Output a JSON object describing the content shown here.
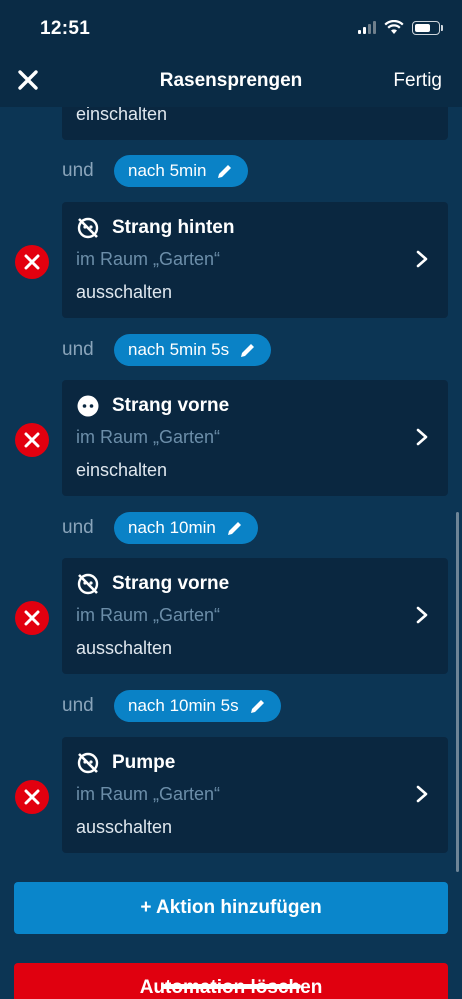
{
  "status_bar": {
    "time": "12:51"
  },
  "nav": {
    "title": "Rasensprengen",
    "done_label": "Fertig"
  },
  "partial_card": {
    "action": "einschalten"
  },
  "steps": [
    {
      "connector": "und",
      "delay": "nach  5min"
    },
    {
      "connector": "und",
      "delay": "nach  5min 5s"
    },
    {
      "connector": "und",
      "delay": "nach  10min"
    },
    {
      "connector": "und",
      "delay": "nach  10min 5s"
    }
  ],
  "actions": [
    {
      "icon": "socket-off-icon",
      "title": "Strang hinten",
      "room": "im Raum „Garten“",
      "action": "ausschalten"
    },
    {
      "icon": "socket-icon",
      "title": "Strang vorne",
      "room": "im Raum „Garten“",
      "action": "einschalten"
    },
    {
      "icon": "socket-off-icon",
      "title": "Strang vorne",
      "room": "im Raum „Garten“",
      "action": "ausschalten"
    },
    {
      "icon": "socket-off-icon",
      "title": "Pumpe",
      "room": "im Raum „Garten“",
      "action": "ausschalten"
    }
  ],
  "buttons": {
    "add_action": "+ Aktion hinzufügen",
    "delete_automation": "Automation löschen"
  },
  "colors": {
    "background": "#0c3554",
    "card": "#0a2740",
    "accent": "#0a86cb",
    "danger": "#e2000f"
  }
}
